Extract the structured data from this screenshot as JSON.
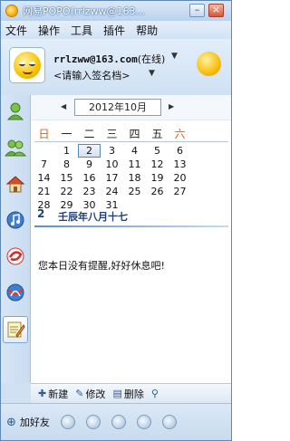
{
  "titlebar": {
    "title": "网易POPO(rrlzww@163...",
    "minimize_label": "–",
    "close_label": "×"
  },
  "menu": [
    "文件",
    "操作",
    "工具",
    "插件",
    "帮助"
  ],
  "profile": {
    "account": "rrlzww@163.com",
    "status": "(在线)",
    "signature": "<请输入签名档>"
  },
  "calendar": {
    "month_label": "2012年10月",
    "prev_arrow": "◀",
    "next_arrow": "▶",
    "weekdays": [
      "日",
      "一",
      "二",
      "三",
      "四",
      "五",
      "六"
    ],
    "weeks": [
      [
        "",
        "1",
        "2",
        "3",
        "4",
        "5",
        "6"
      ],
      [
        "7",
        "8",
        "9",
        "10",
        "11",
        "12",
        "13"
      ],
      [
        "14",
        "15",
        "16",
        "17",
        "18",
        "19",
        "20"
      ],
      [
        "21",
        "22",
        "23",
        "24",
        "25",
        "26",
        "27"
      ],
      [
        "28",
        "29",
        "30",
        "31",
        "",
        "",
        ""
      ]
    ],
    "today": "2",
    "selected_date": "2",
    "lunar_date": "壬辰年八月十七",
    "note": "您本日没有提醒,好好休息吧!",
    "colors": {
      "weekend": "#e05a0a",
      "accent": "#1f3f7a"
    }
  },
  "actions": {
    "new_label": "新建",
    "edit_label": "修改",
    "delete_label": "删除"
  },
  "footer": {
    "add_friend_label": "加好友"
  }
}
